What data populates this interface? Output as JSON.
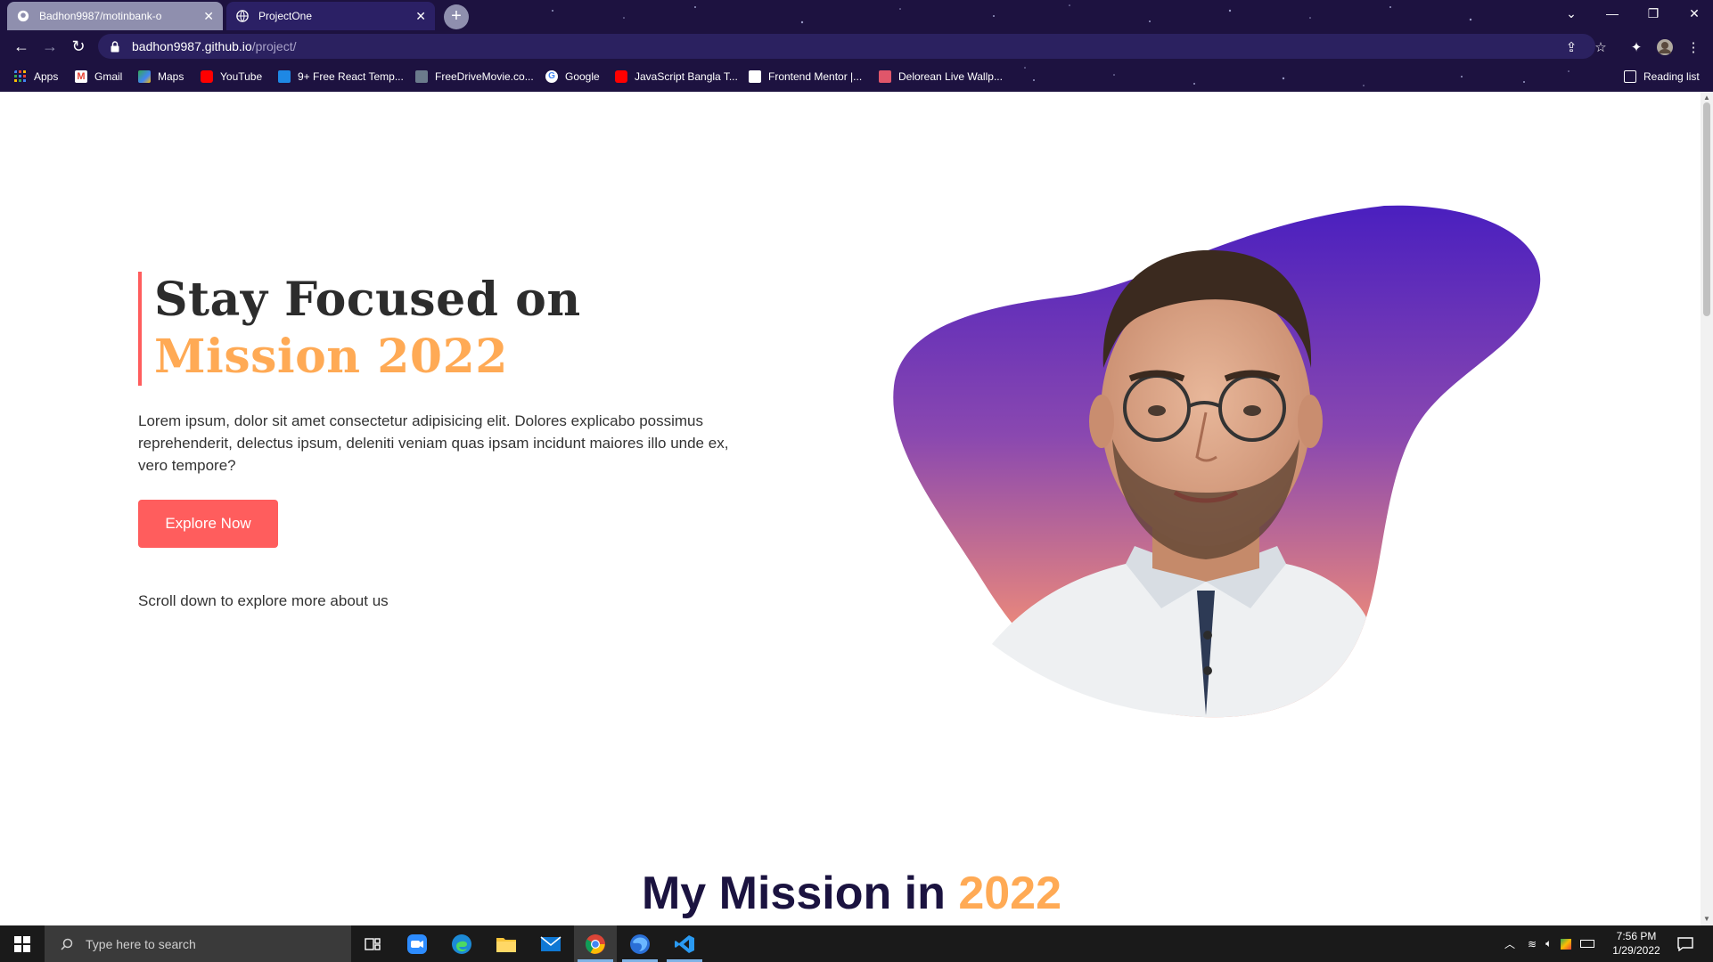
{
  "browser": {
    "tabs": [
      {
        "title": "Badhon9987/motinbank-o",
        "icon": "github-icon"
      },
      {
        "title": "ProjectOne",
        "icon": "globe-icon",
        "active": true
      }
    ],
    "address": {
      "host": "badhon9987.github.io",
      "path": "/project/"
    },
    "bookmarks": [
      {
        "label": "Apps",
        "icon": "apps-grid-icon",
        "color": "#4285f4"
      },
      {
        "label": "Gmail",
        "icon": "gmail-icon",
        "color": "#ea4335"
      },
      {
        "label": "Maps",
        "icon": "maps-icon",
        "color": "#34a853"
      },
      {
        "label": "YouTube",
        "icon": "youtube-icon",
        "color": "#ff0000"
      },
      {
        "label": "9+ Free React Temp...",
        "icon": "mui-icon",
        "color": "#1e88e5"
      },
      {
        "label": "FreeDriveMovie.co...",
        "icon": "film-icon",
        "color": "#6b7b8c"
      },
      {
        "label": "Google",
        "icon": "google-icon",
        "color": "#ffffff"
      },
      {
        "label": "JavaScript Bangla T...",
        "icon": "youtube-icon",
        "color": "#ff0000"
      },
      {
        "label": "Frontend Mentor |...",
        "icon": "frontend-mentor-icon",
        "color": "#ffffff"
      },
      {
        "label": "Delorean Live Wallp...",
        "icon": "wallpaper-icon",
        "color": "#e0566a"
      }
    ],
    "reading_list": "Reading list"
  },
  "hero": {
    "title_line1": "Stay Focused on",
    "title_line2": "Mission 2022",
    "paragraph": "Lorem ipsum, dolor sit amet consectetur adipisicing elit. Dolores explicabo possimus reprehenderit, delectus ipsum, deleniti veniam quas ipsam incidunt maiores illo unde ex, vero tempore?",
    "button": "Explore Now",
    "scroll_hint": "Scroll down to explore more about us",
    "accent": "#ff5d5d",
    "highlight": "#ffaa55"
  },
  "mission": {
    "title": "My Mission in ",
    "year": "2022"
  },
  "taskbar": {
    "search_placeholder": "Type here to search",
    "time": "7:56 PM",
    "date": "1/29/2022",
    "apps": [
      "task-view-icon",
      "zoom-icon",
      "edge-icon",
      "file-explorer-icon",
      "mail-icon",
      "chrome-icon",
      "firefox-icon",
      "vscode-icon"
    ]
  }
}
